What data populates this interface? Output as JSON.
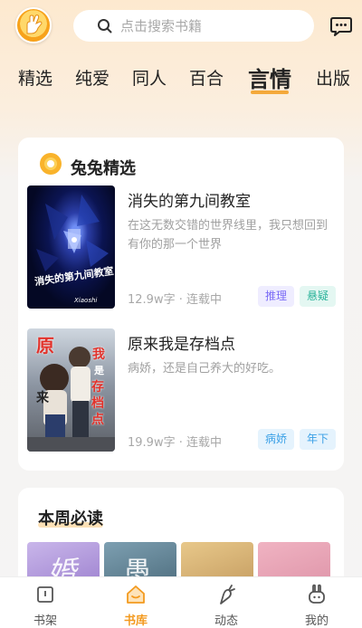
{
  "header": {
    "logo_icon": "rabbit-hand-logo",
    "search_placeholder": "点击搜索书籍",
    "message_icon": "chat-bubble-icon"
  },
  "tabs": [
    {
      "label": "精选",
      "active": false
    },
    {
      "label": "纯爱",
      "active": false
    },
    {
      "label": "同人",
      "active": false
    },
    {
      "label": "百合",
      "active": false
    },
    {
      "label": "言情",
      "active": true
    },
    {
      "label": "出版",
      "active": false
    }
  ],
  "featured": {
    "title": "兔兔精选",
    "books": [
      {
        "title": "消失的第九间教室",
        "description": "在这无数交错的世界线里，我只想回到有你的那一个世界",
        "meta": "12.9w字 · 连载中",
        "cover_text": "消失的第九间教室",
        "cover_sub": "Xiaoshi",
        "tags": [
          {
            "label": "推理",
            "color": "#7b6cf6",
            "bg": "#efedff"
          },
          {
            "label": "悬疑",
            "color": "#2bb39a",
            "bg": "#e4f7f2"
          }
        ]
      },
      {
        "title": "原来我是存档点",
        "description": "病娇，还是自己养大的好吃。",
        "meta": "19.9w字 · 连载中",
        "cover_text_left": "原",
        "cover_text_left2": "来",
        "cover_text_right": "我",
        "cover_text_right2": "是",
        "cover_text_right3": "存",
        "cover_text_right4": "档",
        "cover_text_right5": "点",
        "tags": [
          {
            "label": "病娇",
            "color": "#3aa0e6",
            "bg": "#e5f3fd"
          },
          {
            "label": "年下",
            "color": "#3aa0e6",
            "bg": "#e5f3fd"
          }
        ]
      }
    ]
  },
  "weekly": {
    "title": "本周必读",
    "thumbs": [
      {
        "glyph": "婚",
        "bg": "linear-gradient(160deg,#c9b6ea,#8e6fc6)"
      },
      {
        "glyph": "愚",
        "bg": "linear-gradient(160deg,#7d9fb1,#3d5c6c)"
      },
      {
        "glyph": "",
        "bg": "linear-gradient(160deg,#e8c88a,#b98e53)"
      },
      {
        "glyph": "",
        "bg": "linear-gradient(160deg,#f0b3c2,#d88aa0)"
      }
    ]
  },
  "bottom_nav": [
    {
      "label": "书架",
      "icon": "bookshelf-icon",
      "active": false
    },
    {
      "label": "书库",
      "icon": "home-library-icon",
      "active": true
    },
    {
      "label": "动态",
      "icon": "carrot-icon",
      "active": false
    },
    {
      "label": "我的",
      "icon": "rabbit-profile-icon",
      "active": false
    }
  ],
  "colors": {
    "accent": "#f39a1f",
    "underline": "#f4a93b"
  }
}
